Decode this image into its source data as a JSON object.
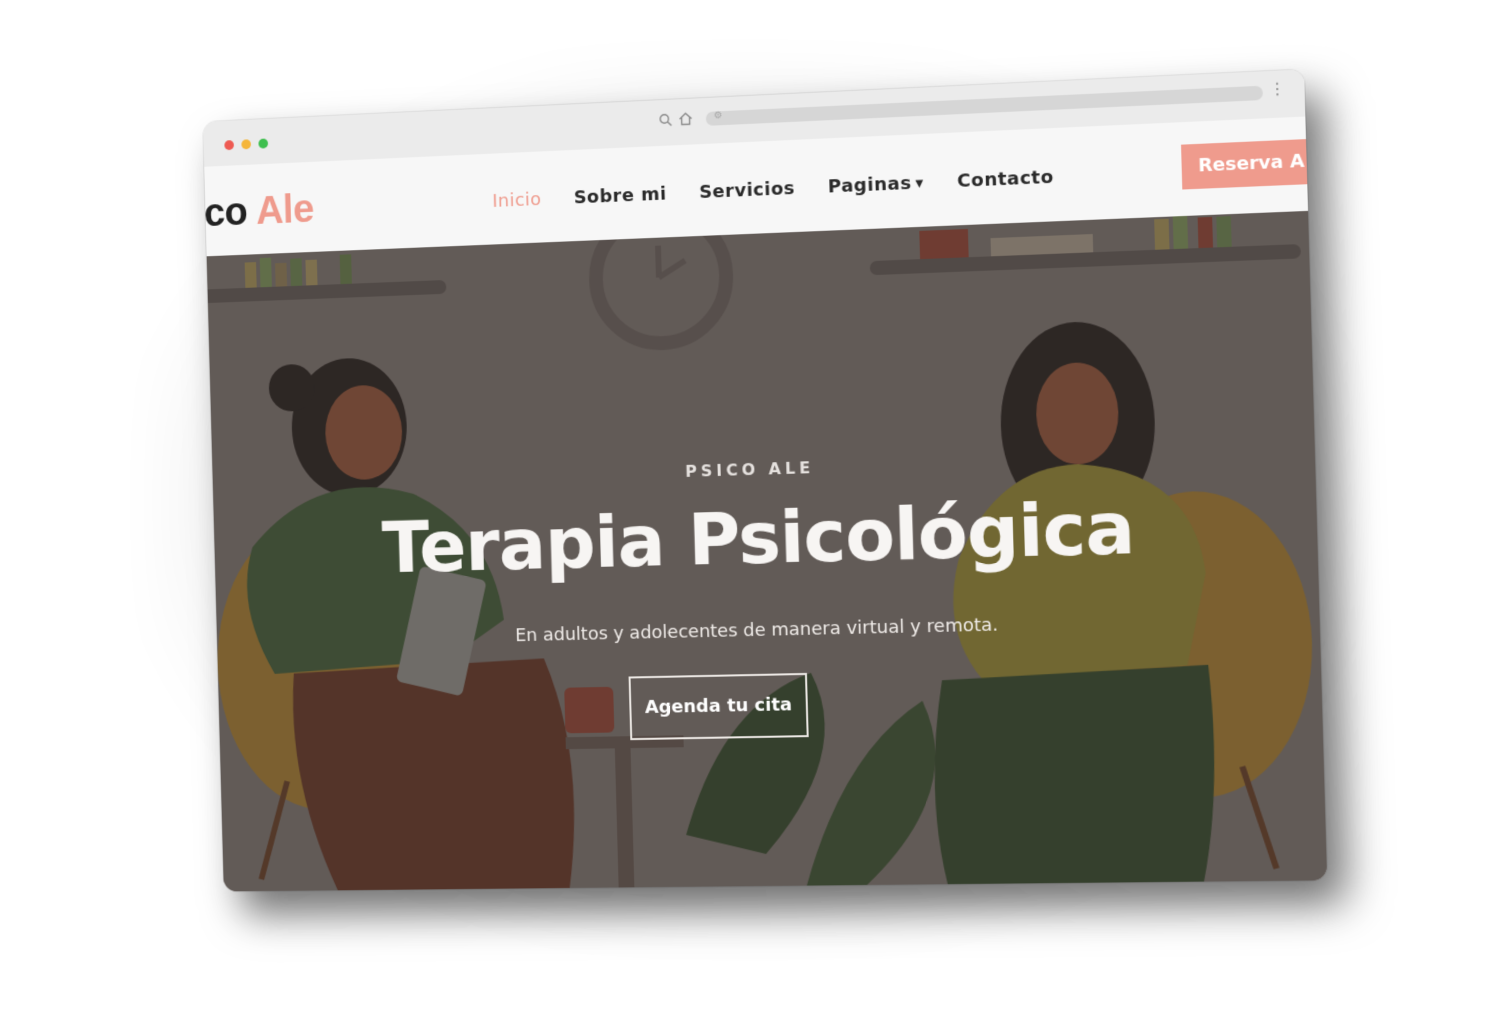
{
  "browser": {
    "window_controls": [
      "close",
      "minimize",
      "maximize"
    ],
    "toolbar_icons": [
      "search-icon",
      "home-icon",
      "menu-dots-icon"
    ]
  },
  "site": {
    "brand_part1": "ico",
    "brand_part2": "Ale",
    "brand_color": "#ef9b8d",
    "nav": {
      "items": [
        {
          "label": "Inicio",
          "active": true
        },
        {
          "label": "Sobre mi"
        },
        {
          "label": "Servicios"
        },
        {
          "label": "Paginas"
        },
        {
          "label": "Contacto"
        }
      ]
    },
    "cta_label": "Reserva A"
  },
  "hero": {
    "eyebrow": "PSICO ALE",
    "title": "Terapia Psicológica",
    "subtitle": "En adultos y adolecentes de manera virtual y remota.",
    "button_label": "Agenda tu cita"
  }
}
